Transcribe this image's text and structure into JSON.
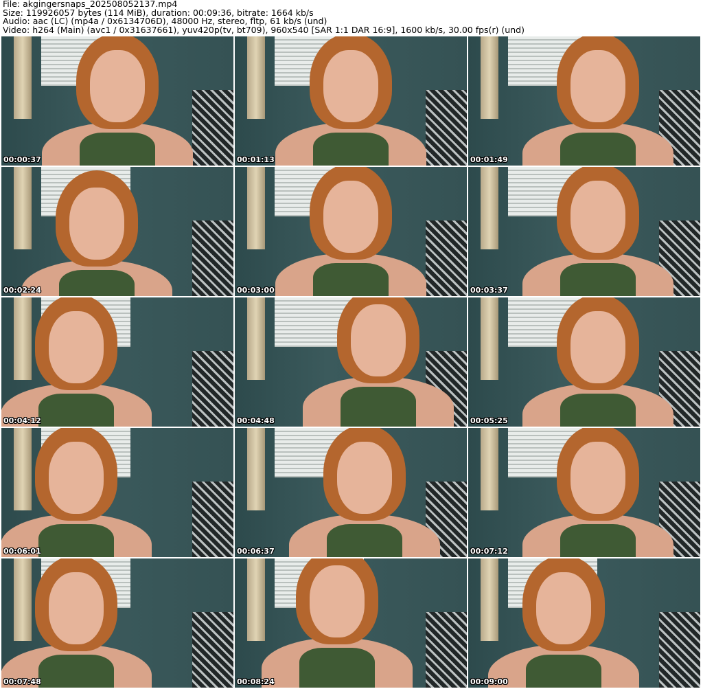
{
  "header": {
    "file": "File: akgingersnaps_202508052137.mp4",
    "size": "Size: 119926057 bytes (114 MiB), duration: 00:09:36, bitrate: 1664 kb/s",
    "audio": "Audio: aac (LC) (mp4a / 0x6134706D), 48000 Hz, stereo, fltp, 61 kb/s (und)",
    "video": "Video: h264 (Main) (avc1 / 0x31637661), yuv420p(tv, bt709), 960x540 [SAR 1:1 DAR 16:9], 1600 kb/s, 30.00 fps(r) (und)"
  },
  "thumbnails": [
    {
      "timestamp": "00:00:37"
    },
    {
      "timestamp": "00:01:13"
    },
    {
      "timestamp": "00:01:49"
    },
    {
      "timestamp": "00:02:24"
    },
    {
      "timestamp": "00:03:00"
    },
    {
      "timestamp": "00:03:37"
    },
    {
      "timestamp": "00:04:12"
    },
    {
      "timestamp": "00:04:48"
    },
    {
      "timestamp": "00:05:25"
    },
    {
      "timestamp": "00:06:01"
    },
    {
      "timestamp": "00:06:37"
    },
    {
      "timestamp": "00:07:12"
    },
    {
      "timestamp": "00:07:48"
    },
    {
      "timestamp": "00:08:24"
    },
    {
      "timestamp": "00:09:00"
    }
  ]
}
